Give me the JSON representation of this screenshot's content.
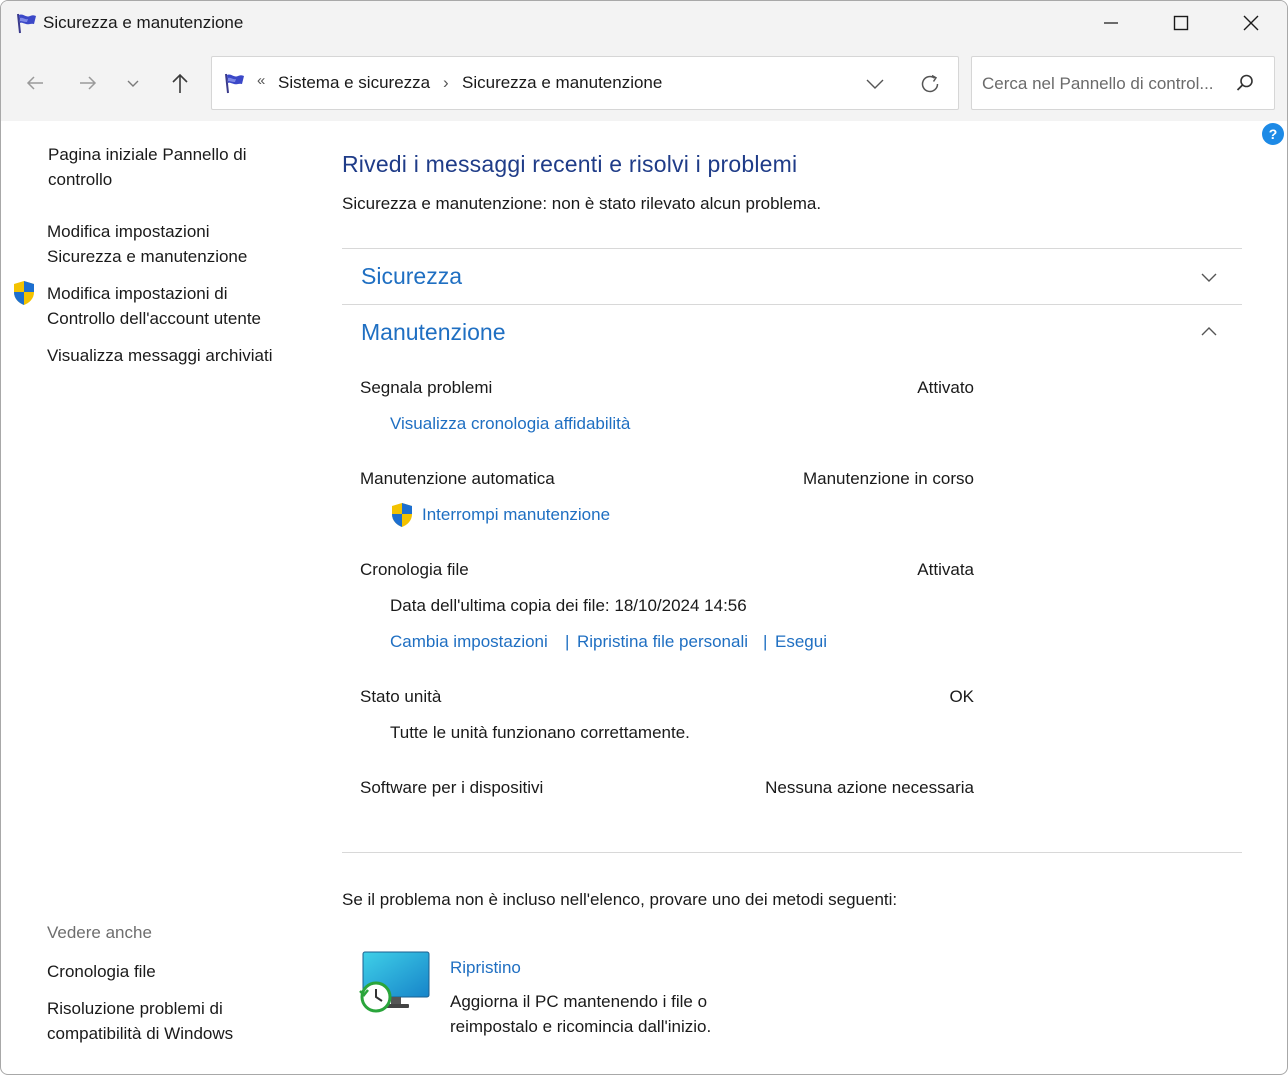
{
  "window": {
    "title": "Sicurezza e manutenzione",
    "icon": "flag-icon"
  },
  "nav": {
    "breadcrumb_prefix": "«",
    "breadcrumb": [
      "Sistema e sicurezza",
      "Sicurezza e manutenzione"
    ],
    "breadcrumb_separator": "›",
    "search_placeholder": "Cerca nel Pannello di control..."
  },
  "help": {
    "label": "?"
  },
  "sidebar": {
    "links": [
      {
        "text_line1": "Pagina iniziale Pannello di",
        "text_line2": "controllo"
      },
      {
        "text_line1": "Modifica impostazioni",
        "text_line2": "Sicurezza e manutenzione"
      },
      {
        "text_line1": "Modifica impostazioni di",
        "text_line2": "Controllo dell'account utente",
        "icon": "uac-shield-icon"
      },
      {
        "text_line1": "Visualizza messaggi archiviati"
      }
    ],
    "see_also_label": "Vedere anche",
    "see_also": [
      {
        "text_line1": "Cronologia file"
      },
      {
        "text_line1": "Risoluzione problemi di",
        "text_line2": "compatibilità di Windows"
      }
    ]
  },
  "main": {
    "heading": "Rivedi i messaggi recenti e risolvi i problemi",
    "status": "Sicurezza e manutenzione: non è stato rilevato alcun problema.",
    "sections": {
      "security": {
        "title": "Sicurezza",
        "expanded": false
      },
      "maintenance": {
        "title": "Manutenzione",
        "expanded": true,
        "rows": {
          "report": {
            "label": "Segnala problemi",
            "value": "Attivato",
            "link": "Visualizza cronologia affidabilità"
          },
          "auto": {
            "label": "Manutenzione automatica",
            "value": "Manutenzione in corso",
            "link": "Interrompi manutenzione"
          },
          "history": {
            "label": "Cronologia file",
            "value": "Attivata",
            "info": "Data dell'ultima copia dei file: 18/10/2024 14:56",
            "links": [
              "Cambia impostazioni",
              "Ripristina file personali",
              "Esegui"
            ],
            "separator": "|"
          },
          "drives": {
            "label": "Stato unità",
            "value": "OK",
            "info": "Tutte le unità funzionano correttamente."
          },
          "devices": {
            "label": "Software per i dispositivi",
            "value": "Nessuna azione necessaria"
          }
        }
      }
    },
    "try_text": "Se il problema non è incluso nell'elenco, provare uno dei metodi seguenti:",
    "recovery": {
      "title": "Ripristino",
      "desc_line1": "Aggiorna il PC mantenendo i file o",
      "desc_line2": "reimpostalo e ricomincia dall'inizio."
    }
  },
  "colors": {
    "heading": "#1f3c88",
    "link": "#1f6fc2",
    "chrome": "#f3f3f3",
    "help": "#1d8ae6"
  }
}
